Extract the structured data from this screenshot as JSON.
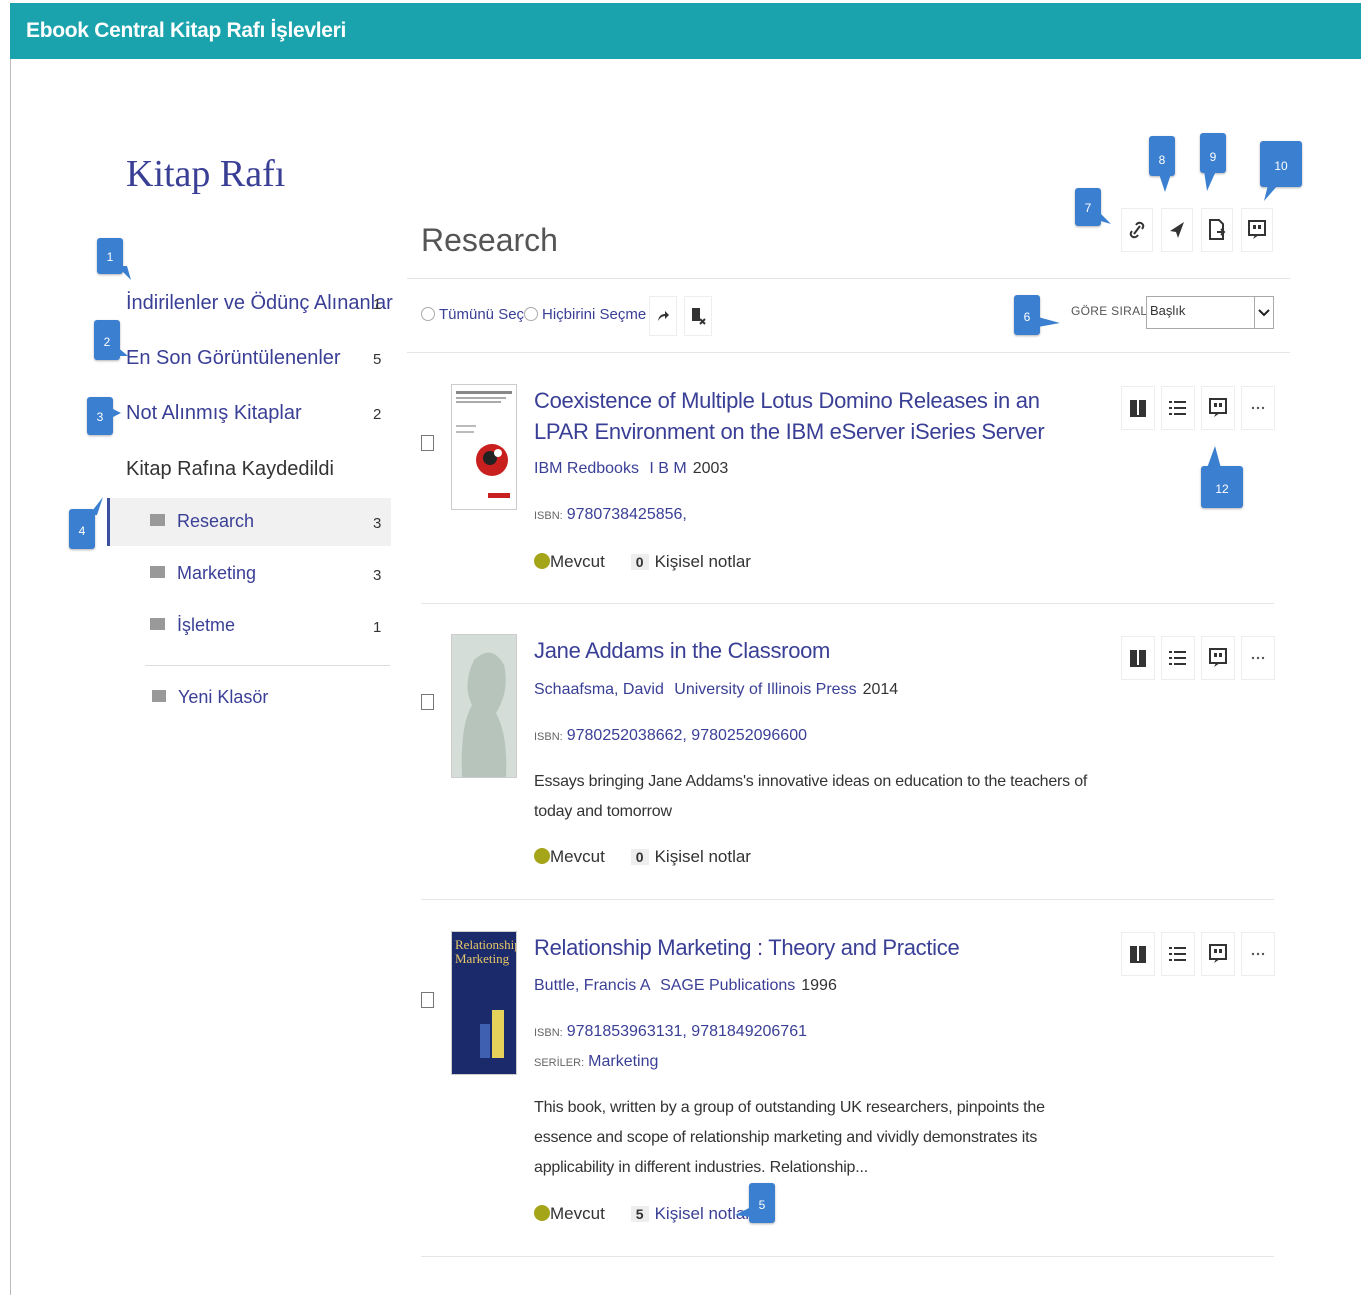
{
  "header": {
    "title": "Ebook Central Kitap Rafı İşlevleri"
  },
  "sidebar": {
    "title": "Kitap Rafı",
    "items": [
      {
        "label": "İndirilenler ve Ödünç Alınanlar",
        "count": "1"
      },
      {
        "label": "En Son Görüntülenenler",
        "count": "5"
      },
      {
        "label": "Not Alınmış Kitaplar",
        "count": "2"
      }
    ],
    "saved_heading": "Kitap Rafına Kaydedildi",
    "folders": [
      {
        "label": "Research",
        "count": "3",
        "selected": true
      },
      {
        "label": "Marketing",
        "count": "3"
      },
      {
        "label": "İşletme",
        "count": "1"
      }
    ],
    "new_folder": "Yeni Klasör"
  },
  "main": {
    "title": "Research",
    "toolbar": {
      "select_all": "Tümünü Seç",
      "select_none": "Hiçbirini Seçme",
      "sort_label": "GÖRE SIRALA",
      "sort_value": "Başlık"
    },
    "books": [
      {
        "title": "Coexistence of Multiple Lotus Domino Releases in an LPAR Environment on the IBM eServer iSeries Server",
        "author": "IBM Redbooks",
        "publisher": "I B M",
        "year": "2003",
        "isbn_label": "ISBN:",
        "isbn": "9780738425856,",
        "availability": "Mevcut",
        "notes_count": "0",
        "notes_label": "Kişisel notlar"
      },
      {
        "title": "Jane Addams in the Classroom",
        "author": "Schaafsma, David",
        "publisher": "University of Illinois Press",
        "year": "2014",
        "isbn_label": "ISBN:",
        "isbn": "9780252038662, 9780252096600",
        "description": "Essays bringing Jane Addams's innovative ideas on education to the teachers of today and tomorrow",
        "availability": "Mevcut",
        "notes_count": "0",
        "notes_label": "Kişisel notlar"
      },
      {
        "title": "Relationship Marketing : Theory and Practice",
        "author": "Buttle, Francis A",
        "publisher": "SAGE Publications",
        "year": "1996",
        "isbn_label": "ISBN:",
        "isbn": "9781853963131, 9781849206761",
        "series_label": "SERİLER:",
        "series": "Marketing",
        "description": "This book, written by a group of outstanding UK researchers, pinpoints the essence and scope of relationship marketing and vividly demonstrates its applicability in different industries. Relationship...",
        "availability": "Mevcut",
        "notes_count": "5",
        "notes_label": "Kişisel notlar",
        "cover_text": "Relationship Marketing"
      }
    ]
  },
  "callouts": [
    "1",
    "2",
    "3",
    "4",
    "5",
    "6",
    "7",
    "8",
    "9",
    "10",
    "12"
  ],
  "colors": {
    "header": "#1aa3ac",
    "link": "#3a3f96",
    "badge": "#3b7fd0",
    "available": "#a5a51a"
  },
  "icons": {
    "top_actions": [
      "link-icon",
      "send-icon",
      "export-icon",
      "citation-icon"
    ],
    "row_actions": [
      "read-book-icon",
      "table-of-contents-icon",
      "citation-icon",
      "more-icon"
    ]
  }
}
